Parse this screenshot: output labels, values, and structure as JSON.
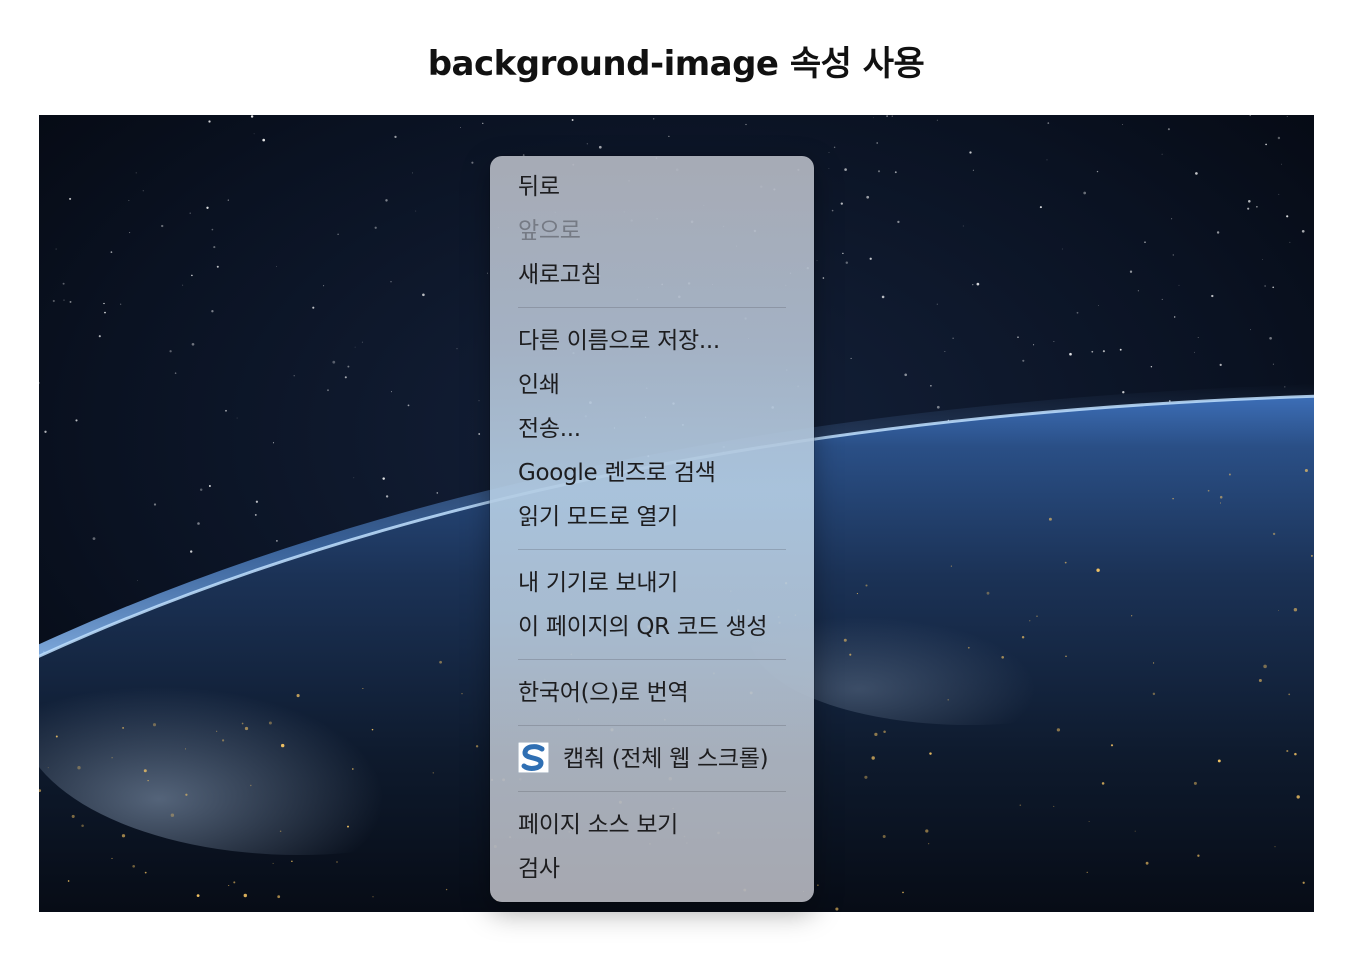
{
  "page": {
    "title": "background-image 속성 사용"
  },
  "context_menu": {
    "groups": [
      [
        {
          "label": "뒤로",
          "enabled": true
        },
        {
          "label": "앞으로",
          "enabled": false
        },
        {
          "label": "새로고침",
          "enabled": true
        }
      ],
      [
        {
          "label": "다른 이름으로 저장...",
          "enabled": true
        },
        {
          "label": "인쇄",
          "enabled": true
        },
        {
          "label": "전송...",
          "enabled": true
        },
        {
          "label": "Google 렌즈로 검색",
          "enabled": true
        },
        {
          "label": "읽기 모드로 열기",
          "enabled": true
        }
      ],
      [
        {
          "label": "내 기기로 보내기",
          "enabled": true
        },
        {
          "label": "이 페이지의 QR 코드 생성",
          "enabled": true
        }
      ],
      [
        {
          "label": "한국어(으)로 번역",
          "enabled": true
        }
      ],
      [
        {
          "label": "캡춰 (전체 웹 스크롤)",
          "enabled": true,
          "icon": "s-extension-icon"
        }
      ],
      [
        {
          "label": "페이지 소스 보기",
          "enabled": true
        },
        {
          "label": "검사",
          "enabled": true
        }
      ]
    ]
  },
  "colors": {
    "disabled_text": "#8e8e93",
    "menu_text": "#1d1d1f",
    "ext_icon_blue": "#2f6fb3"
  }
}
